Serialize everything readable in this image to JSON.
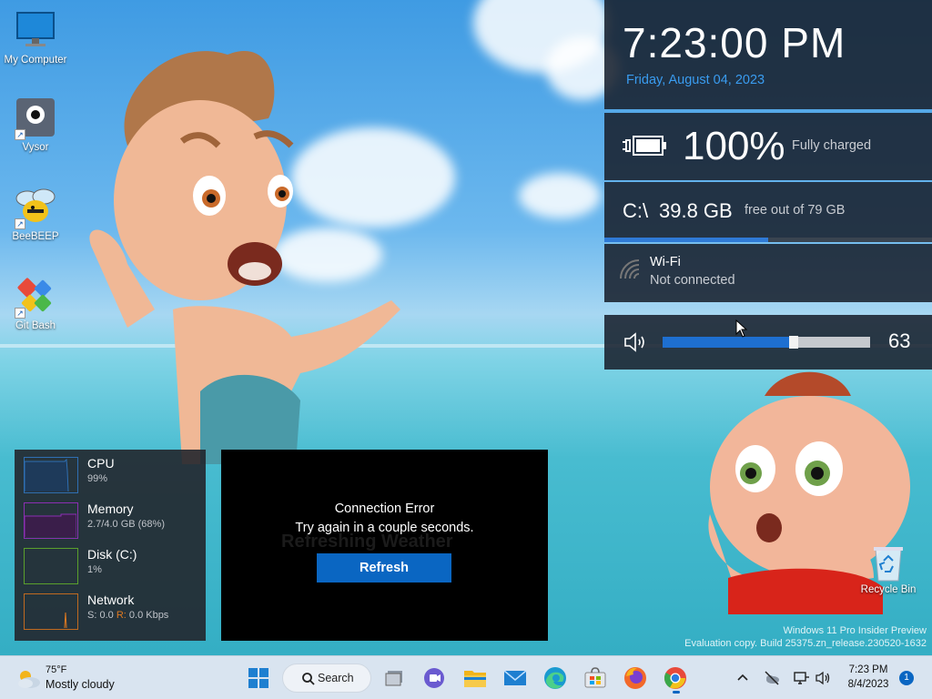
{
  "desktop": {
    "icons": [
      {
        "label": "My Computer"
      },
      {
        "label": "Vysor"
      },
      {
        "label": "BeeBEEP"
      },
      {
        "label": "Git Bash"
      }
    ],
    "recycle_bin": {
      "label": "Recycle Bin"
    },
    "watermark": {
      "line1": "Windows 11 Pro Insider Preview",
      "line2": "Evaluation copy. Build 25375.zn_release.230520-1632"
    }
  },
  "info_panel": {
    "clock": {
      "time": "7:23:00 PM",
      "date": "Friday, August 04, 2023",
      "date_color": "#3a9cf0"
    },
    "battery": {
      "percent_text": "100%",
      "percent": 100,
      "status": "Fully charged"
    },
    "disk": {
      "drive": "C:\\",
      "free": "39.8 GB",
      "detail": "free out of 79 GB",
      "used_fraction": 0.5
    },
    "wifi": {
      "title": "Wi-Fi",
      "status": "Not connected"
    },
    "volume": {
      "value_text": "63",
      "level": 0.63
    }
  },
  "system_monitor": {
    "rows": [
      {
        "name": "CPU",
        "value": "99%",
        "color": "#2f6fb3"
      },
      {
        "name": "Memory",
        "value": "2.7/4.0 GB (68%)",
        "color": "#8b2fb3"
      },
      {
        "name": "Disk (C:)",
        "value": "1%",
        "color": "#5aa02c"
      },
      {
        "name": "Network",
        "value_s_label": "S:",
        "value_s": "0.0",
        "value_r_label": "R:",
        "value_r": "0.0 Kbps",
        "color": "#c06a20"
      }
    ]
  },
  "weather_widget": {
    "ghost_text": "Refreshing Weather",
    "title": "Connection Error",
    "message": "Try again in a couple seconds.",
    "button_label": "Refresh",
    "button_color": "#0a66c2"
  },
  "taskbar": {
    "weather": {
      "temp": "75°F",
      "condition": "Mostly cloudy"
    },
    "search_label": "Search",
    "apps": [
      "start-icon",
      "search-icon",
      "task-view-icon",
      "teams-icon",
      "file-explorer-icon",
      "mail-icon",
      "edge-icon",
      "store-icon",
      "firefox-icon",
      "chrome-icon"
    ],
    "tray": {
      "time": "7:23 PM",
      "date": "8/4/2023",
      "notification_count": "1"
    }
  }
}
